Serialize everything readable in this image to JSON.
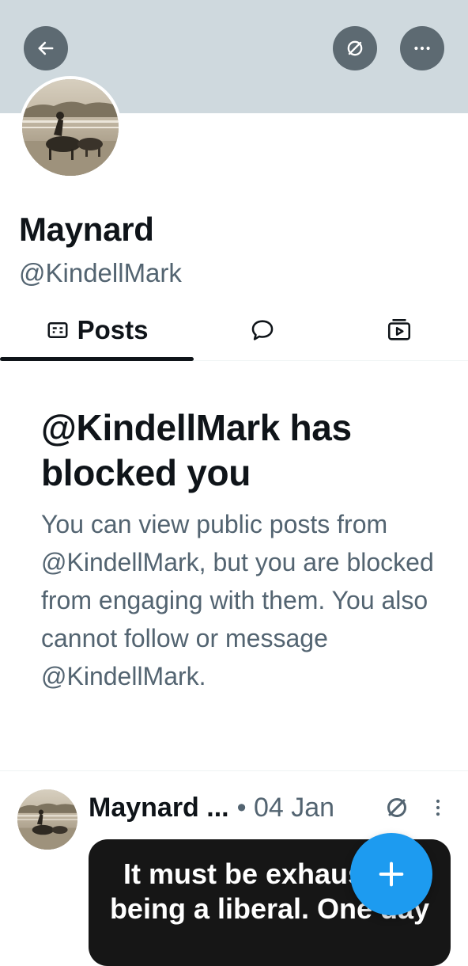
{
  "header": {
    "back_icon": "arrow-left-icon",
    "grok_icon": "grok-icon",
    "more_icon": "more-horizontal-icon",
    "banner_color": "#cfd9de"
  },
  "profile": {
    "display_name": "Maynard",
    "handle": "@KindellMark"
  },
  "tabs": [
    {
      "label": "Posts",
      "icon": "posts-icon",
      "active": true
    },
    {
      "label": "",
      "icon": "replies-icon",
      "active": false
    },
    {
      "label": "",
      "icon": "media-icon",
      "active": false
    }
  ],
  "blocked": {
    "title": "@KindellMark has blocked you",
    "body": "You can view public posts from @KindellMark, but you are blocked from engaging with them. You also cannot follow or message @KindellMark."
  },
  "post": {
    "author": "Maynard ...",
    "date": "• 04 Jan",
    "media_text": "It must be exhausting being a liberal. One day"
  },
  "fab": {
    "icon": "plus-icon",
    "color": "#1d9bf0"
  }
}
